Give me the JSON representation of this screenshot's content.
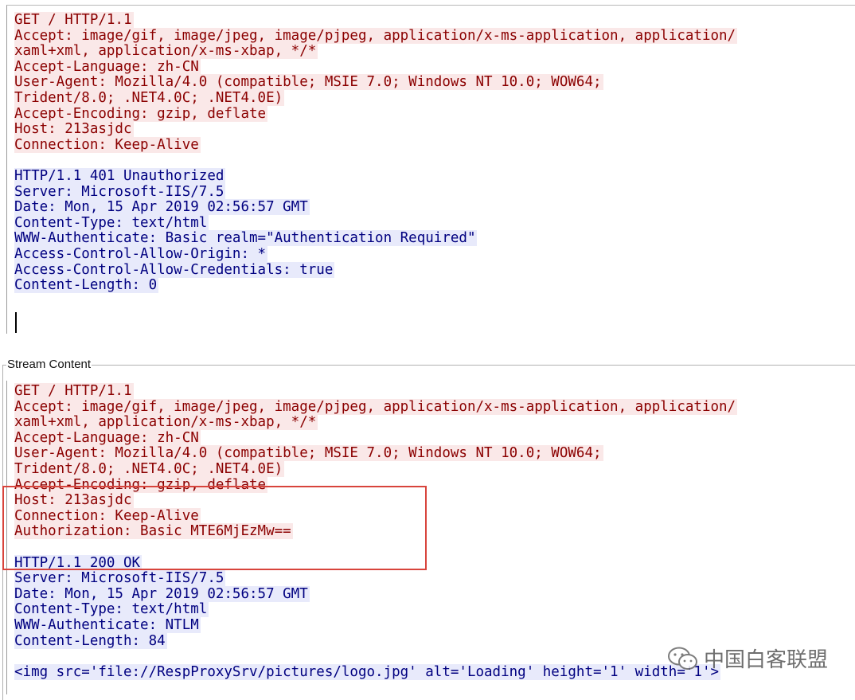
{
  "panel_top": {
    "request_lines": [
      "GET / HTTP/1.1",
      "Accept: image/gif, image/jpeg, image/pjpeg, application/x-ms-application, application/",
      "xaml+xml, application/x-ms-xbap, */*",
      "Accept-Language: zh-CN",
      "User-Agent: Mozilla/4.0 (compatible; MSIE 7.0; Windows NT 10.0; WOW64;",
      "Trident/8.0; .NET4.0C; .NET4.0E)",
      "Accept-Encoding: gzip, deflate",
      "Host: 213asjdc",
      "Connection: Keep-Alive"
    ],
    "response_lines": [
      "HTTP/1.1 401 Unauthorized",
      "Server: Microsoft-IIS/7.5",
      "Date: Mon, 15 Apr 2019 02:56:57 GMT",
      "Content-Type: text/html",
      "WWW-Authenticate: Basic realm=\"Authentication Required\"",
      "Access-Control-Allow-Origin: *",
      "Access-Control-Allow-Credentials: true",
      "Content-Length: 0"
    ]
  },
  "panel_bottom": {
    "group_title": "Stream Content",
    "request_lines": [
      "GET / HTTP/1.1",
      "Accept: image/gif, image/jpeg, image/pjpeg, application/x-ms-application, application/",
      "xaml+xml, application/x-ms-xbap, */*",
      "Accept-Language: zh-CN",
      "User-Agent: Mozilla/4.0 (compatible; MSIE 7.0; Windows NT 10.0; WOW64;",
      "Trident/8.0; .NET4.0C; .NET4.0E)",
      "Accept-Encoding: gzip, deflate",
      "Host: 213asjdc",
      "Connection: Keep-Alive",
      "Authorization: Basic MTE6MjEzMw=="
    ],
    "response_lines": [
      "HTTP/1.1 200 OK",
      "Server: Microsoft-IIS/7.5",
      "Date: Mon, 15 Apr 2019 02:56:57 GMT",
      "Content-Type: text/html",
      "WWW-Authenticate: NTLM",
      "Content-Length: 84",
      "",
      "<img src='file://RespProxySrv/pictures/logo.jpg' alt='Loading' height='1' width='1'>"
    ]
  },
  "watermark": {
    "text": "中国白客联盟",
    "icon": "wechat-icon"
  },
  "colors": {
    "request_bg": "#fae8e8",
    "request_fg": "#8b0000",
    "response_bg": "#e8eafb",
    "response_fg": "#000080",
    "highlight_border": "#d8443c"
  }
}
